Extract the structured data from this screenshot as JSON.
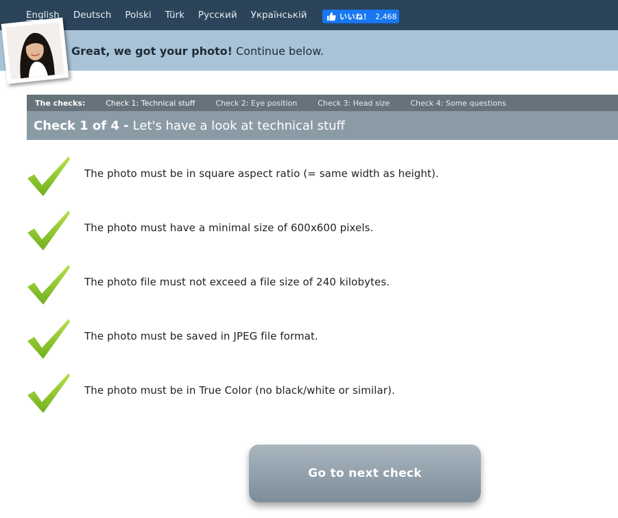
{
  "languages": [
    "English",
    "Deutsch",
    "Polski",
    "Türk",
    "Русский",
    "Українській"
  ],
  "active_language": "English",
  "fb_like": {
    "label": "いいね！",
    "count": "2,468",
    "color": "#1877f2"
  },
  "notice": {
    "bold": "Great, we got your photo!",
    "rest": " Continue below."
  },
  "tabs": {
    "label": "The checks:",
    "items": [
      "Check 1: Technical stuff",
      "Check 2: Eye position",
      "Check 3: Head size",
      "Check 4: Some questions"
    ]
  },
  "section": {
    "bold": "Check 1 of 4 -",
    "title": "Let's have a look at technical stuff"
  },
  "checks": [
    "The photo must be in square aspect ratio (= same width as height).",
    "The photo must have a minimal size of 600x600 pixels.",
    "The photo file must not exceed a file size of 240 kilobytes.",
    "The photo must be saved in JPEG file format.",
    "The photo must be in True Color (no black/white or similar)."
  ],
  "next_button": "Go to next check",
  "colors": {
    "topbar": "#2b4459",
    "notice": "#a9c3d6",
    "tabs": "#67737b",
    "section": "#8b9ba6",
    "check_green": "#8fce2b"
  }
}
